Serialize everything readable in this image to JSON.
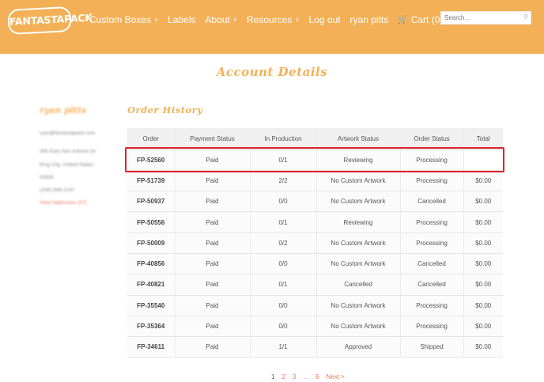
{
  "header": {
    "logo_text": "FANTASTAPACK",
    "nav": [
      {
        "label": "Custom Boxes",
        "caret": "∨"
      },
      {
        "label": "Labels",
        "caret": ""
      },
      {
        "label": "About",
        "caret": "∨"
      },
      {
        "label": "Resources",
        "caret": "∨"
      },
      {
        "label": "Log out",
        "caret": ""
      },
      {
        "label": "ryan pitts",
        "caret": ""
      }
    ],
    "cart_label": "Cart (0)",
    "search_placeholder": "Search...",
    "search_icon": "magnifier-icon",
    "background_color": "#f4b057"
  },
  "page_title": "Account Details",
  "sidebar": {
    "name": "ryan pitts",
    "email": "ryan@fantastapack.com",
    "address_line1": "395 East San Antonio Dr",
    "address_line2": "King City, United States",
    "zip": "93930",
    "phone": "(206) 898-2147",
    "addresses_link": "View Addresses (37)"
  },
  "order_history": {
    "title": "Order History",
    "columns": [
      "Order",
      "Payment Status",
      "In Production",
      "Artwork Status",
      "Order Status",
      "Total"
    ],
    "rows": [
      {
        "order": "FP-52560",
        "payment": "Paid",
        "production": "0/1",
        "artwork": "Reviewing",
        "status": "Processing",
        "total": ""
      },
      {
        "order": "FP-51739",
        "payment": "Paid",
        "production": "2/2",
        "artwork": "No Custom Artwork",
        "status": "Processing",
        "total": "$0.00"
      },
      {
        "order": "FP-50937",
        "payment": "Paid",
        "production": "0/0",
        "artwork": "No Custom Artwork",
        "status": "Cancelled",
        "total": "$0.00"
      },
      {
        "order": "FP-50556",
        "payment": "Paid",
        "production": "0/1",
        "artwork": "Reviewing",
        "status": "Processing",
        "total": "$0.00"
      },
      {
        "order": "FP-50009",
        "payment": "Paid",
        "production": "0/2",
        "artwork": "No Custom Artwork",
        "status": "Processing",
        "total": "$0.00"
      },
      {
        "order": "FP-40856",
        "payment": "Paid",
        "production": "0/0",
        "artwork": "No Custom Artwork",
        "status": "Cancelled",
        "total": "$0.00"
      },
      {
        "order": "FP-40821",
        "payment": "Paid",
        "production": "0/1",
        "artwork": "Cancelled",
        "status": "Cancelled",
        "total": "$0.00"
      },
      {
        "order": "FP-35540",
        "payment": "Paid",
        "production": "0/0",
        "artwork": "No Custom Artwork",
        "status": "Processing",
        "total": "$0.00"
      },
      {
        "order": "FP-35364",
        "payment": "Paid",
        "production": "0/0",
        "artwork": "No Custom Artwork",
        "status": "Processing",
        "total": "$0.00"
      },
      {
        "order": "FP-34611",
        "payment": "Paid",
        "production": "1/1",
        "artwork": "Approved",
        "status": "Shipped",
        "total": "$0.00"
      }
    ],
    "highlight_color": "#e0212b"
  },
  "pagination": {
    "current": "1",
    "pages": [
      "2",
      "3"
    ],
    "ellipsis": "...",
    "last": "6",
    "next": "Next >"
  },
  "colors": {
    "accent": "#f4b057",
    "link": "#e8735e"
  }
}
